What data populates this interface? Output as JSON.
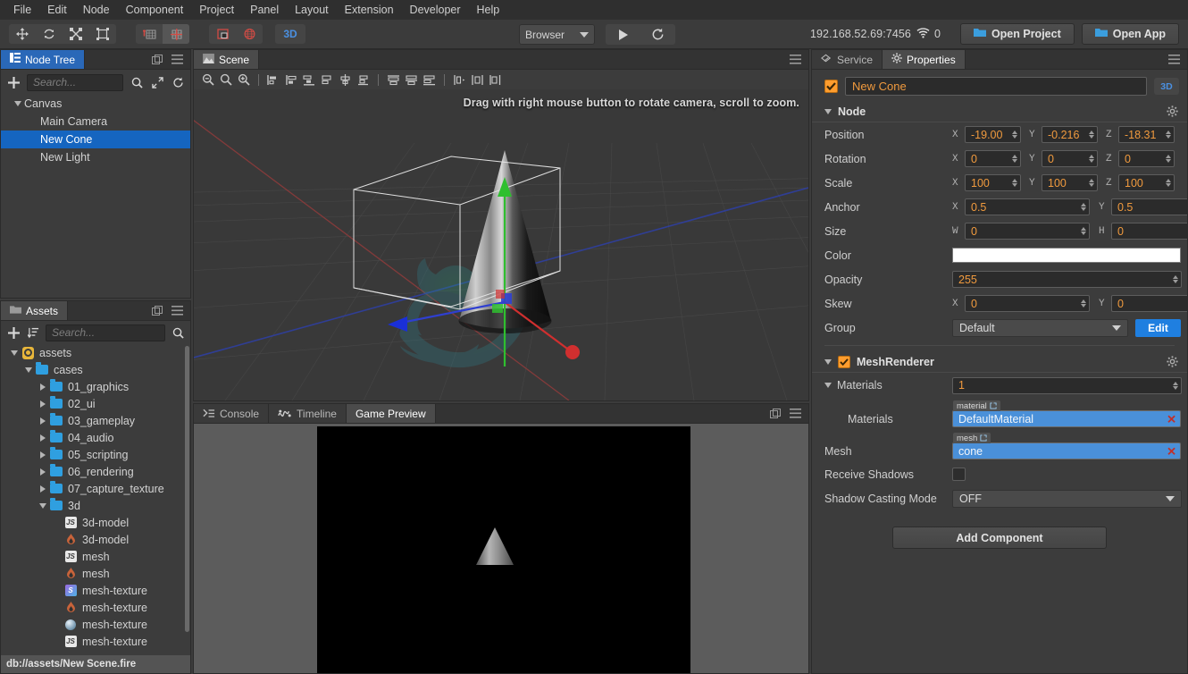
{
  "menubar": {
    "items": [
      "File",
      "Edit",
      "Node",
      "Component",
      "Project",
      "Panel",
      "Layout",
      "Extension",
      "Developer",
      "Help"
    ]
  },
  "toolbar": {
    "tools": [
      {
        "name": "move-tool",
        "icon": "move-icon"
      },
      {
        "name": "rotate-tool",
        "icon": "rotate-icon"
      },
      {
        "name": "scale-tool",
        "icon": "scale-icon"
      },
      {
        "name": "rect-tool",
        "icon": "rect-transform-icon"
      }
    ],
    "pivot_tools": [
      {
        "name": "pivot-center-tool",
        "icon": "pivot-icon"
      },
      {
        "name": "pivot-pos-tool",
        "icon": "anchor-icon"
      }
    ],
    "coord_tools": [
      {
        "name": "local-space-tool",
        "icon": "local-coord-icon"
      },
      {
        "name": "global-space-tool",
        "icon": "global-coord-icon"
      }
    ],
    "mode_3d_label": "3D",
    "device_select": "Browser",
    "play_label": "play-icon",
    "refresh_label": "refresh-icon",
    "ip_address": "192.168.52.69:7456",
    "device_count": "0",
    "open_project_label": "Open Project",
    "open_app_label": "Open App"
  },
  "node_tree": {
    "tab_label": "Node Tree",
    "search_placeholder": "Search...",
    "nodes": [
      {
        "label": "Canvas",
        "depth": 0,
        "expandable": true,
        "expanded": true,
        "selected": false
      },
      {
        "label": "Main Camera",
        "depth": 1,
        "expandable": false,
        "expanded": false,
        "selected": false
      },
      {
        "label": "New Cone",
        "depth": 1,
        "expandable": false,
        "expanded": false,
        "selected": true
      },
      {
        "label": "New Light",
        "depth": 1,
        "expandable": false,
        "expanded": false,
        "selected": false
      }
    ]
  },
  "assets": {
    "tab_label": "Assets",
    "search_placeholder": "Search...",
    "status_path": "db://assets/New Scene.fire",
    "items": [
      {
        "label": "assets",
        "depth": 0,
        "icon": "db-icon",
        "expandable": true,
        "expanded": true
      },
      {
        "label": "cases",
        "depth": 1,
        "icon": "folder-icon",
        "expandable": true,
        "expanded": true
      },
      {
        "label": "01_graphics",
        "depth": 2,
        "icon": "folder-icon",
        "expandable": true,
        "expanded": false
      },
      {
        "label": "02_ui",
        "depth": 2,
        "icon": "folder-icon",
        "expandable": true,
        "expanded": false
      },
      {
        "label": "03_gameplay",
        "depth": 2,
        "icon": "folder-icon",
        "expandable": true,
        "expanded": false
      },
      {
        "label": "04_audio",
        "depth": 2,
        "icon": "folder-icon",
        "expandable": true,
        "expanded": false
      },
      {
        "label": "05_scripting",
        "depth": 2,
        "icon": "folder-icon",
        "expandable": true,
        "expanded": false
      },
      {
        "label": "06_rendering",
        "depth": 2,
        "icon": "folder-icon",
        "expandable": true,
        "expanded": false
      },
      {
        "label": "07_capture_texture",
        "depth": 2,
        "icon": "folder-icon",
        "expandable": true,
        "expanded": false
      },
      {
        "label": "3d",
        "depth": 2,
        "icon": "folder-icon",
        "expandable": true,
        "expanded": true
      },
      {
        "label": "3d-model",
        "depth": 3,
        "icon": "js-icon",
        "expandable": false,
        "expanded": false
      },
      {
        "label": "3d-model",
        "depth": 3,
        "icon": "fire-icon",
        "expandable": false,
        "expanded": false
      },
      {
        "label": "mesh",
        "depth": 3,
        "icon": "js-icon",
        "expandable": false,
        "expanded": false
      },
      {
        "label": "mesh",
        "depth": 3,
        "icon": "fire-icon",
        "expandable": false,
        "expanded": false
      },
      {
        "label": "mesh-texture",
        "depth": 3,
        "icon": "scene-icon",
        "expandable": false,
        "expanded": false
      },
      {
        "label": "mesh-texture",
        "depth": 3,
        "icon": "fire-icon",
        "expandable": false,
        "expanded": false
      },
      {
        "label": "mesh-texture",
        "depth": 3,
        "icon": "sphere-icon",
        "expandable": false,
        "expanded": false
      },
      {
        "label": "mesh-texture",
        "depth": 3,
        "icon": "js-icon",
        "expandable": false,
        "expanded": false
      }
    ]
  },
  "scene": {
    "tab_label": "Scene",
    "hint": "Drag with right mouse button to rotate camera, scroll to zoom.",
    "align_tools": [
      {
        "name": "zoom-out-tool",
        "icon": "magnifier-minus-icon"
      },
      {
        "name": "zoom-reset-tool",
        "icon": "magnifier-icon"
      },
      {
        "name": "zoom-in-tool",
        "icon": "magnifier-plus-icon"
      },
      {
        "name": "align-left-tool",
        "icon": "align-left-icon"
      },
      {
        "name": "align-hcenter-tool",
        "icon": "align-hcenter-icon"
      },
      {
        "name": "align-right-tool",
        "icon": "align-right-icon"
      },
      {
        "name": "align-top-tool",
        "icon": "align-top-icon"
      },
      {
        "name": "align-vcenter-tool",
        "icon": "align-vcenter-icon"
      },
      {
        "name": "align-bottom-tool",
        "icon": "align-bottom-icon"
      },
      {
        "name": "distribute-h-tool",
        "icon": "distribute-h-icon"
      },
      {
        "name": "distribute-v-tool",
        "icon": "distribute-v-icon"
      },
      {
        "name": "distribute-gap-tool",
        "icon": "distribute-gap-icon"
      }
    ]
  },
  "bottom_panel": {
    "tabs": [
      {
        "label": "Console",
        "icon": "console-icon",
        "active": false
      },
      {
        "label": "Timeline",
        "icon": "timeline-icon",
        "active": false
      },
      {
        "label": "Game Preview",
        "icon": "",
        "active": true
      }
    ]
  },
  "properties": {
    "tabs": [
      {
        "label": "Service",
        "icon": "service-icon",
        "active": false
      },
      {
        "label": "Properties",
        "icon": "gear-icon",
        "active": true
      }
    ],
    "node_name": "New Cone",
    "node_enabled": true,
    "badge_3d": "3D",
    "node_section": {
      "title": "Node",
      "rows": [
        {
          "label": "Position",
          "kind": "vec3",
          "axes": [
            "X",
            "Y",
            "Z"
          ],
          "values": [
            "-19.00",
            "-0.216",
            "-18.31"
          ]
        },
        {
          "label": "Rotation",
          "kind": "vec3",
          "axes": [
            "X",
            "Y",
            "Z"
          ],
          "values": [
            "0",
            "0",
            "0"
          ]
        },
        {
          "label": "Scale",
          "kind": "vec3",
          "axes": [
            "X",
            "Y",
            "Z"
          ],
          "values": [
            "100",
            "100",
            "100"
          ]
        },
        {
          "label": "Anchor",
          "kind": "vec2",
          "axes": [
            "X",
            "Y"
          ],
          "values": [
            "0.5",
            "0.5"
          ]
        },
        {
          "label": "Size",
          "kind": "vec2",
          "axes": [
            "W",
            "H"
          ],
          "values": [
            "0",
            "0"
          ]
        },
        {
          "label": "Color",
          "kind": "color",
          "value": "#ffffff"
        },
        {
          "label": "Opacity",
          "kind": "number",
          "value": "255"
        },
        {
          "label": "Skew",
          "kind": "vec2",
          "axes": [
            "X",
            "Y"
          ],
          "values": [
            "0",
            "0"
          ]
        },
        {
          "label": "Group",
          "kind": "select",
          "value": "Default",
          "button": "Edit"
        }
      ]
    },
    "mesh_renderer": {
      "title": "MeshRenderer",
      "enabled": true,
      "materials_count": "1",
      "materials_label": "Materials",
      "materials_sub_label": "Materials",
      "material_tag": "material",
      "material_value": "DefaultMaterial",
      "mesh_label": "Mesh",
      "mesh_tag": "mesh",
      "mesh_value": "cone",
      "receive_shadows_label": "Receive Shadows",
      "receive_shadows": false,
      "shadow_mode_label": "Shadow Casting Mode",
      "shadow_mode_value": "OFF"
    },
    "add_component_label": "Add Component"
  },
  "colors": {
    "accent_orange": "#f09a3e",
    "accent_blue": "#1565c0",
    "asset_blue": "#4a90d9",
    "edit_button": "#1f7fe0",
    "panel_bg": "#3c3c3c"
  }
}
